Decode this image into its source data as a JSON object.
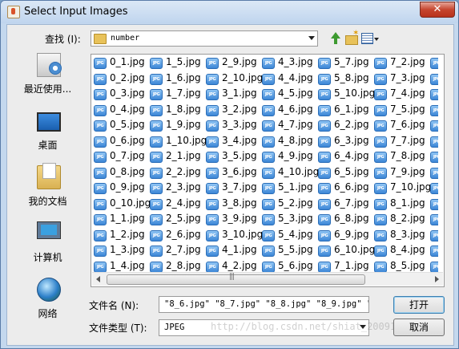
{
  "window": {
    "title": "Select Input Images",
    "close_glyph": "✕"
  },
  "lookin": {
    "label": "查找 (I):",
    "value": "number"
  },
  "places": [
    {
      "label": "最近使用...",
      "icon": "recent-items-icon"
    },
    {
      "label": "桌面",
      "icon": "desktop-icon"
    },
    {
      "label": "我的文档",
      "icon": "documents-folder-icon"
    },
    {
      "label": "计算机",
      "icon": "computer-icon"
    },
    {
      "label": "网络",
      "icon": "network-globe-icon"
    }
  ],
  "file_icon_text": "JPG",
  "files": [
    [
      "0_1.jpg",
      "0_2.jpg",
      "0_3.jpg",
      "0_4.jpg",
      "0_5.jpg",
      "0_6.jpg",
      "0_7.jpg",
      "0_8.jpg",
      "0_9.jpg",
      "0_10.jpg",
      "1_1.jpg",
      "1_2.jpg",
      "1_3.jpg",
      "1_4.jpg"
    ],
    [
      "1_5.jpg",
      "1_6.jpg",
      "1_7.jpg",
      "1_8.jpg",
      "1_9.jpg",
      "1_10.jpg",
      "2_1.jpg",
      "2_2.jpg",
      "2_3.jpg",
      "2_4.jpg",
      "2_5.jpg",
      "2_6.jpg",
      "2_7.jpg",
      "2_8.jpg"
    ],
    [
      "2_9.jpg",
      "2_10.jpg",
      "3_1.jpg",
      "3_2.jpg",
      "3_3.jpg",
      "3_4.jpg",
      "3_5.jpg",
      "3_6.jpg",
      "3_7.jpg",
      "3_8.jpg",
      "3_9.jpg",
      "3_10.jpg",
      "4_1.jpg",
      "4_2.jpg"
    ],
    [
      "4_3.jpg",
      "4_4.jpg",
      "4_5.jpg",
      "4_6.jpg",
      "4_7.jpg",
      "4_8.jpg",
      "4_9.jpg",
      "4_10.jpg",
      "5_1.jpg",
      "5_2.jpg",
      "5_3.jpg",
      "5_4.jpg",
      "5_5.jpg",
      "5_6.jpg"
    ],
    [
      "5_7.jpg",
      "5_8.jpg",
      "5_10.jpg",
      "6_1.jpg",
      "6_2.jpg",
      "6_3.jpg",
      "6_4.jpg",
      "6_5.jpg",
      "6_6.jpg",
      "6_7.jpg",
      "6_8.jpg",
      "6_9.jpg",
      "6_10.jpg",
      "7_1.jpg"
    ],
    [
      "7_2.jpg",
      "7_3.jpg",
      "7_4.jpg",
      "7_5.jpg",
      "7_6.jpg",
      "7_7.jpg",
      "7_8.jpg",
      "7_9.jpg",
      "7_10.jpg",
      "8_1.jpg",
      "8_2.jpg",
      "8_3.jpg",
      "8_4.jpg",
      "8_5.jpg"
    ]
  ],
  "filename": {
    "label": "文件名 (N):",
    "value": "\"8_6.jpg\" \"8_7.jpg\" \"8_8.jpg\" \"8_9.jpg\" \"8"
  },
  "filetype": {
    "label": "文件类型 (T):",
    "value": "JPEG"
  },
  "buttons": {
    "open": "打开",
    "cancel": "取消"
  },
  "watermark": "http://blog.csdn.net/shiat_20091171"
}
